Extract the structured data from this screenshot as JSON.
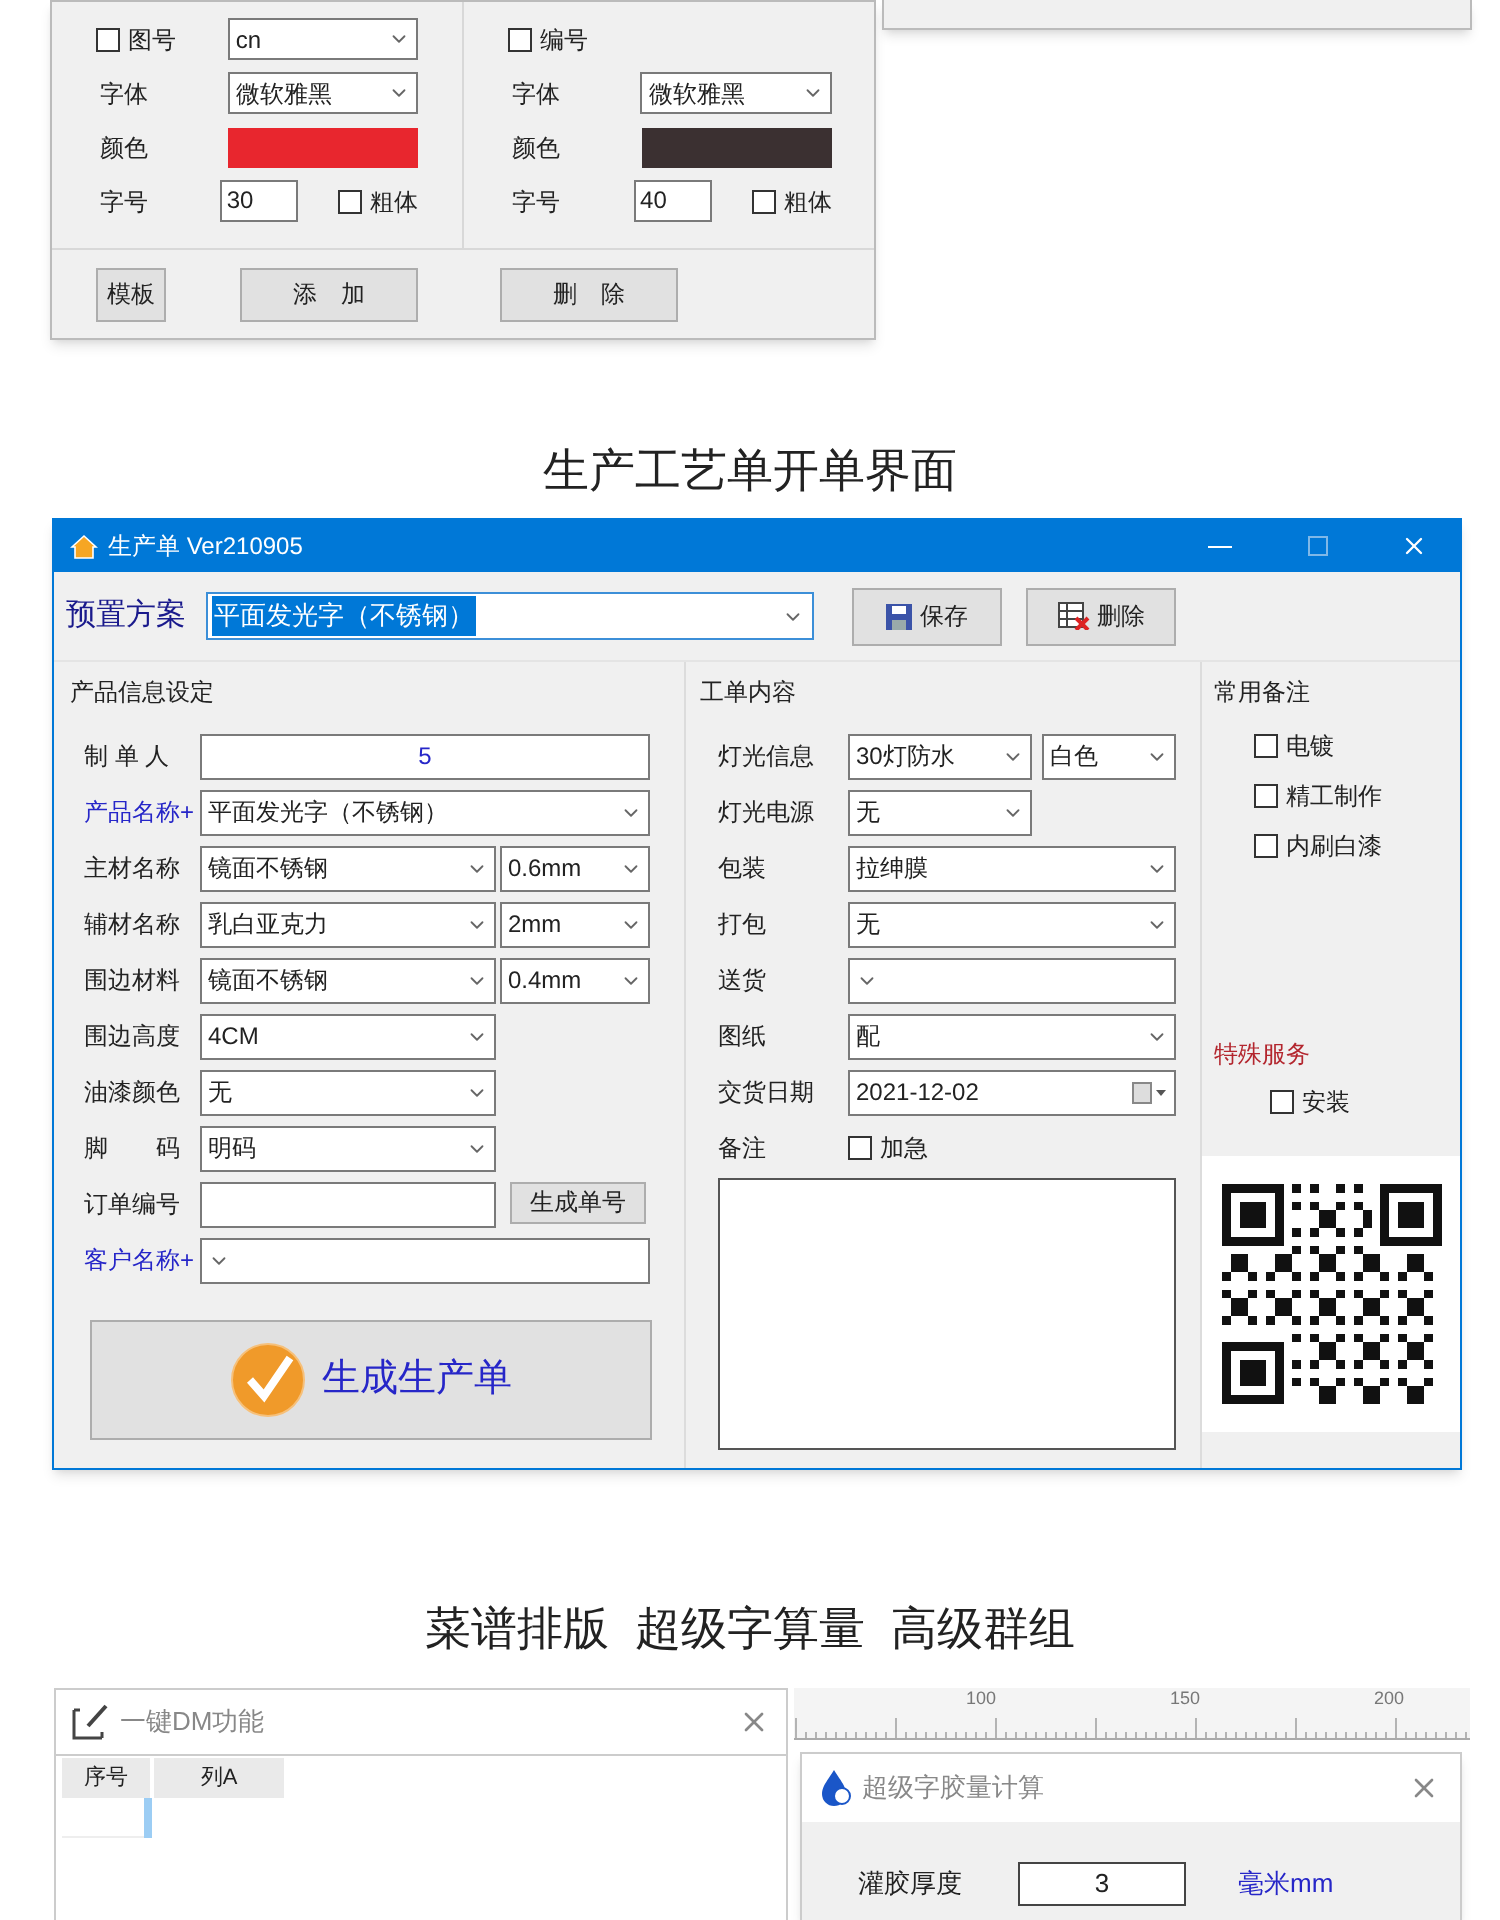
{
  "text_settings": [
    {
      "checkbox": {
        "label": "图号",
        "checked": false
      },
      "select_value": "cn",
      "font_label": "字体",
      "font_value": "微软雅黑",
      "color_label": "颜色",
      "color": "#e8262e",
      "size_label": "字号",
      "size_value": "30",
      "bold": {
        "label": "粗体",
        "checked": false
      }
    },
    {
      "checkbox": {
        "label": "编号",
        "checked": false
      },
      "font_label": "字体",
      "font_value": "微软雅黑",
      "color_label": "颜色",
      "color": "#3b3031",
      "size_label": "字号",
      "size_value": "40",
      "bold": {
        "label": "粗体",
        "checked": false
      }
    }
  ],
  "text_settings_buttons": [
    {
      "label": "模板",
      "kind": "small"
    },
    {
      "label": "添　加",
      "kind": "wide"
    },
    {
      "label": "删　除",
      "kind": "wide"
    }
  ],
  "order_heading": "生产工艺单开单界面",
  "order_window": {
    "title": "生产单 Ver210905",
    "preset": {
      "label": "预置方案",
      "value": "平面发光字（不锈钢）"
    },
    "toolbar_buttons": [
      {
        "label": "保存",
        "kind": "save"
      },
      {
        "label": "删除",
        "kind": "delete"
      }
    ],
    "product_info": {
      "title": "产品信息设定",
      "rows": [
        {
          "label": "制 单 人",
          "kind": "text",
          "value": "5",
          "link": false
        },
        {
          "label": "产品名称+",
          "kind": "select",
          "value": "平面发光字（不锈钢）",
          "link": true
        },
        {
          "label": "主材名称",
          "kind": "select_pair",
          "value": "镜面不锈钢",
          "value2": "0.6mm",
          "link": false
        },
        {
          "label": "辅材名称",
          "kind": "select_pair",
          "value": "乳白亚克力",
          "value2": "2mm",
          "link": false
        },
        {
          "label": "围边材料",
          "kind": "select_pair",
          "value": "镜面不锈钢",
          "value2": "0.4mm",
          "link": false
        },
        {
          "label": "围边高度",
          "kind": "select_mid",
          "value": "4CM",
          "link": false
        },
        {
          "label": "油漆颜色",
          "kind": "select_mid",
          "value": "无",
          "link": false
        },
        {
          "label": "脚　　码",
          "kind": "select_mid",
          "value": "明码",
          "link": false
        },
        {
          "label": "订单编号",
          "kind": "text_button",
          "button": "生成单号",
          "link": false
        },
        {
          "label": "客户名称+",
          "kind": "select",
          "link": true
        }
      ],
      "generate_button": "生成生产单"
    },
    "work_content": {
      "title": "工单内容",
      "rows": [
        {
          "label": "灯光信息",
          "kind": "select_pair",
          "value": "30灯防水",
          "value2": "白色"
        },
        {
          "label": "灯光电源",
          "kind": "select_short",
          "value": "无"
        },
        {
          "label": "包装",
          "kind": "select",
          "value": "拉绅膜"
        },
        {
          "label": "打包",
          "kind": "select",
          "value": "无"
        },
        {
          "label": "送货",
          "kind": "select"
        },
        {
          "label": "图纸",
          "kind": "select",
          "value": "配"
        },
        {
          "label": "交货日期",
          "kind": "date",
          "value": "2021-12-02"
        },
        {
          "label": "备注",
          "kind": "checkbox",
          "checkbox": {
            "label": "加急",
            "checked": false
          }
        }
      ]
    },
    "notes": {
      "title": "常用备注",
      "options": [
        {
          "label": "电镀",
          "checked": false
        },
        {
          "label": "精工制作",
          "checked": false
        },
        {
          "label": "内刷白漆",
          "checked": false
        }
      ],
      "special_title": "特殊服务",
      "special_options": [
        {
          "label": "安装",
          "checked": false
        }
      ]
    }
  },
  "features_heading": "菜谱排版  超级字算量  高级群组",
  "dm_window": {
    "title": "一键DM功能",
    "columns": [
      "序号",
      "列A"
    ]
  },
  "ruler": {
    "ticks": [
      "100",
      "150",
      "200"
    ]
  },
  "glue_dialog": {
    "title": "超级字胶量计算",
    "rows": [
      {
        "label": "灌胶厚度",
        "value": "3",
        "unit": "毫米mm"
      }
    ]
  }
}
